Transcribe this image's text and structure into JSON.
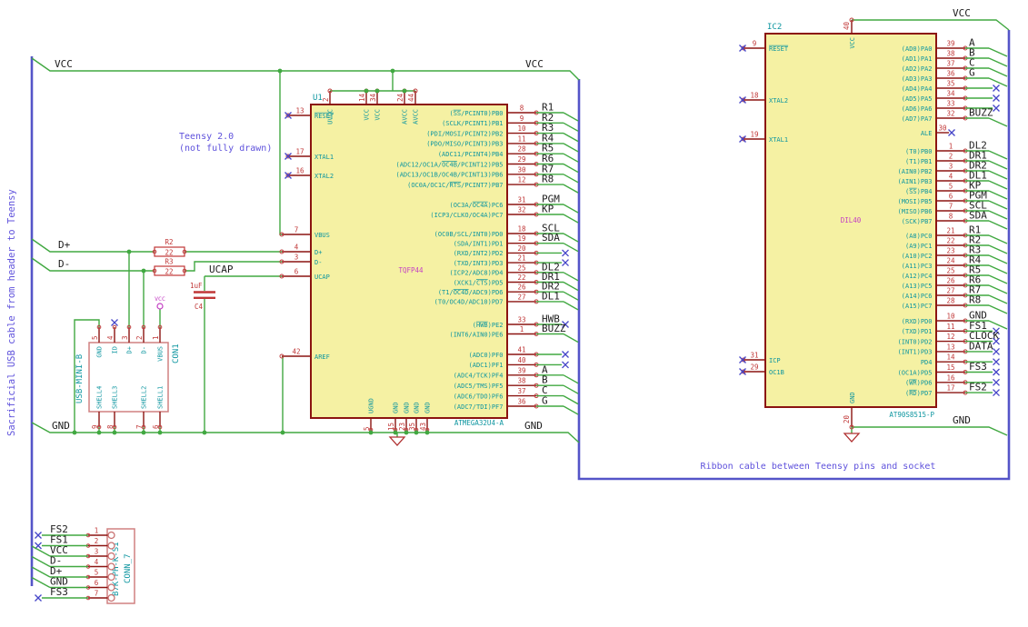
{
  "notes": {
    "side_note": "Sacrificial USB cable from header to Teensy",
    "teensy_note_line1": "Teensy 2.0",
    "teensy_note_line2": "(not fully drawn)",
    "ribbon_note": "Ribbon cable between Teensy pins and socket"
  },
  "flags": {
    "vcc_left": "VCC",
    "vcc_right": "VCC",
    "gnd_left": "GND",
    "gnd_right": "GND",
    "d_plus": "D+",
    "d_minus": "D-",
    "ucap": "UCAP",
    "ic2_vcc": "VCC",
    "ic2_gnd": "GND",
    "usb_vcc": "VCC"
  },
  "colors": {
    "wire": "#41A841",
    "bus": "#5454C8",
    "pin": "#8B1411",
    "pin_number": "#C03636",
    "pin_name": "#0E96A0",
    "reference": "#0E96A0",
    "footprint": "#C43FC4",
    "net_label": "#1C1C1C",
    "no_connect": "#4646C8",
    "note": "#5F52DC",
    "chip_fill": "#F5F1A3"
  },
  "u1": {
    "reference": "U1",
    "part": "ATMEGA32U4-A",
    "footprint": "TQFP44",
    "left_pins": [
      {
        "num": "13",
        "name": "~RESET~",
        "conn": "nc"
      },
      {
        "num": "17",
        "name": "XTAL1",
        "conn": "nc"
      },
      {
        "num": "16",
        "name": "XTAL2",
        "conn": "nc"
      },
      {
        "num": "7",
        "name": "VBUS",
        "conn": "wire"
      },
      {
        "num": "4",
        "name": "D+",
        "conn": "wire"
      },
      {
        "num": "3",
        "name": "D-",
        "conn": "wire"
      },
      {
        "num": "6",
        "name": "UCAP",
        "conn": "wire"
      },
      {
        "num": "42",
        "name": "AREF",
        "conn": "wire"
      }
    ],
    "top_pins": [
      {
        "num": "2",
        "name": "UVCC"
      },
      {
        "num": "14",
        "name": "VCC"
      },
      {
        "num": "34",
        "name": "VCC"
      },
      {
        "num": "24",
        "name": "AVCC"
      },
      {
        "num": "44",
        "name": "AVCC"
      }
    ],
    "bottom_pins": [
      {
        "num": "5",
        "name": "UGND"
      },
      {
        "num": "15",
        "name": "GND"
      },
      {
        "num": "23",
        "name": "GND"
      },
      {
        "num": "35",
        "name": "GND"
      },
      {
        "num": "43",
        "name": "GND"
      }
    ],
    "right_groups": [
      {
        "rows": [
          {
            "num": "8",
            "name": "(~SS~/PCINT0)PB0",
            "net": "R1",
            "conn": "bus"
          },
          {
            "num": "9",
            "name": "(SCLK/PCINT1)PB1",
            "net": "R2",
            "conn": "bus"
          },
          {
            "num": "10",
            "name": "(PDI/MOSI/PCINT2)PB2",
            "net": "R3",
            "conn": "bus"
          },
          {
            "num": "11",
            "name": "(PDO/MISO/PCINT3)PB3",
            "net": "R4",
            "conn": "bus"
          },
          {
            "num": "28",
            "name": "(ADC11/PCINT4)PB4",
            "net": "R5",
            "conn": "bus"
          },
          {
            "num": "29",
            "name": "(ADC12/OC1A/~OC4B~/PCINT12)PB5",
            "net": "R6",
            "conn": "bus"
          },
          {
            "num": "30",
            "name": "(ADC13/OC1B/OC4B/PCINT13)PB6",
            "net": "R7",
            "conn": "bus"
          },
          {
            "num": "12",
            "name": "(OC0A/OC1C/~RTS~/PCINT7)PB7",
            "net": "R8",
            "conn": "bus"
          }
        ]
      },
      {
        "rows": [
          {
            "num": "31",
            "name": "(OC3A/~OC4A~)PC6",
            "net": "PGM",
            "conn": "bus"
          },
          {
            "num": "32",
            "name": "(ICP3/CLKO/OC4A)PC7",
            "net": "KP",
            "conn": "bus"
          }
        ]
      },
      {
        "rows": [
          {
            "num": "18",
            "name": "(OC0B/SCL/INT0)PD0",
            "net": "SCL",
            "conn": "bus"
          },
          {
            "num": "19",
            "name": "(SDA/INT1)PD1",
            "net": "SDA",
            "conn": "bus"
          },
          {
            "num": "20",
            "name": "(RXD/INT2)PD2",
            "net": "",
            "conn": "nc"
          },
          {
            "num": "21",
            "name": "(TXD/INT3)PD3",
            "net": "",
            "conn": "nc"
          },
          {
            "num": "25",
            "name": "(ICP2/ADC8)PD4",
            "net": "DL2",
            "conn": "bus"
          },
          {
            "num": "22",
            "name": "(XCK1/~CTS~)PD5",
            "net": "DR1",
            "conn": "bus"
          },
          {
            "num": "26",
            "name": "(T1/~OC4D~/ADC9)PD6",
            "net": "DR2",
            "conn": "bus"
          },
          {
            "num": "27",
            "name": "(T0/OC4D/ADC10)PD7",
            "net": "DL1",
            "conn": "bus"
          }
        ]
      },
      {
        "rows": [
          {
            "num": "33",
            "name": "(~HWB~)PE2",
            "net": "HWB",
            "conn": "nc"
          },
          {
            "num": "1",
            "name": "(INT6/AIN0)PE6",
            "net": "BUZZ",
            "conn": "bus"
          }
        ]
      },
      {
        "rows": [
          {
            "num": "41",
            "name": "(ADC0)PF0",
            "net": "",
            "conn": "nc"
          },
          {
            "num": "40",
            "name": "(ADC1)PF1",
            "net": "",
            "conn": "nc"
          },
          {
            "num": "39",
            "name": "(ADC4/TCK)PF4",
            "net": "A",
            "conn": "bus"
          },
          {
            "num": "38",
            "name": "(ADC5/TMS)PF5",
            "net": "B",
            "conn": "bus"
          },
          {
            "num": "37",
            "name": "(ADC6/TDO)PF6",
            "net": "C",
            "conn": "bus"
          },
          {
            "num": "36",
            "name": "(ADC7/TDI)PF7",
            "net": "G",
            "conn": "bus"
          }
        ]
      }
    ]
  },
  "ic2": {
    "reference": "IC2",
    "part": "AT90S8515-P",
    "footprint": "DIL40",
    "left_pins": [
      {
        "num": "9",
        "name": "~RESET~"
      },
      {
        "num": "18",
        "name": "XTAL2"
      },
      {
        "num": "19",
        "name": "XTAL1"
      },
      {
        "num": "31",
        "name": "ICP"
      },
      {
        "num": "29",
        "name": "OC1B"
      }
    ],
    "top_pin": {
      "num": "40",
      "name": "VCC"
    },
    "bottom_pin": {
      "num": "20",
      "name": "GND"
    },
    "right_groups": [
      {
        "rows": [
          {
            "num": "39",
            "name": "(AD0)PA0",
            "net": "A",
            "conn": "bus"
          },
          {
            "num": "38",
            "name": "(AD1)PA1",
            "net": "B",
            "conn": "bus"
          },
          {
            "num": "37",
            "name": "(AD2)PA2",
            "net": "C",
            "conn": "bus"
          },
          {
            "num": "36",
            "name": "(AD3)PA3",
            "net": "G",
            "conn": "bus"
          },
          {
            "num": "35",
            "name": "(AD4)PA4",
            "net": "",
            "conn": "nc"
          },
          {
            "num": "34",
            "name": "(AD5)PA5",
            "net": "",
            "conn": "nc"
          },
          {
            "num": "33",
            "name": "(AD6)PA6",
            "net": "",
            "conn": "nc"
          },
          {
            "num": "32",
            "name": "(AD7)PA7",
            "net": "BUZZ",
            "conn": "bus"
          }
        ]
      },
      {
        "rows": [
          {
            "num": "30",
            "name": "ALE",
            "net": "",
            "conn": "nc_pin"
          }
        ]
      },
      {
        "rows": [
          {
            "num": "1",
            "name": "(T0)PB0",
            "net": "DL2",
            "conn": "bus"
          },
          {
            "num": "2",
            "name": "(T1)PB1",
            "net": "DR1",
            "conn": "bus"
          },
          {
            "num": "3",
            "name": "(AIN0)PB2",
            "net": "DR2",
            "conn": "bus"
          },
          {
            "num": "4",
            "name": "(AIN1)PB3",
            "net": "DL1",
            "conn": "bus"
          },
          {
            "num": "5",
            "name": "(~SS~)PB4",
            "net": "KP",
            "conn": "bus"
          },
          {
            "num": "6",
            "name": "(MOSI)PB5",
            "net": "PGM",
            "conn": "bus"
          },
          {
            "num": "7",
            "name": "(MISO)PB6",
            "net": "SCL",
            "conn": "bus"
          },
          {
            "num": "8",
            "name": "(SCK)PB7",
            "net": "SDA",
            "conn": "bus"
          }
        ]
      },
      {
        "rows": [
          {
            "num": "21",
            "name": "(A8)PC0",
            "net": "R1",
            "conn": "bus"
          },
          {
            "num": "22",
            "name": "(A9)PC1",
            "net": "R2",
            "conn": "bus"
          },
          {
            "num": "23",
            "name": "(A10)PC2",
            "net": "R3",
            "conn": "bus"
          },
          {
            "num": "24",
            "name": "(A11)PC3",
            "net": "R4",
            "conn": "bus"
          },
          {
            "num": "25",
            "name": "(A12)PC4",
            "net": "R5",
            "conn": "bus"
          },
          {
            "num": "26",
            "name": "(A13)PC5",
            "net": "R6",
            "conn": "bus"
          },
          {
            "num": "27",
            "name": "(A14)PC6",
            "net": "R7",
            "conn": "bus"
          },
          {
            "num": "28",
            "name": "(A15)PC7",
            "net": "R8",
            "conn": "bus"
          }
        ]
      },
      {
        "rows": [
          {
            "num": "10",
            "name": "(RXD)PD0",
            "net": "GND",
            "conn": "bus"
          },
          {
            "num": "11",
            "name": "(TXD)PD1",
            "net": "FS1",
            "conn": "nc"
          },
          {
            "num": "12",
            "name": "(INT0)PD2",
            "net": "CLOCK",
            "conn": "nc"
          },
          {
            "num": "13",
            "name": "(INT1)PD3",
            "net": "DATA",
            "conn": "nc"
          },
          {
            "num": "14",
            "name": "PD4",
            "net": "",
            "conn": "nc"
          },
          {
            "num": "15",
            "name": "(OC1A)PD5",
            "net": "FS3",
            "conn": "nc"
          },
          {
            "num": "16",
            "name": "(~WR~)PD6",
            "net": "",
            "conn": "nc"
          },
          {
            "num": "17",
            "name": "(~RD~)PD7",
            "net": "FS2",
            "conn": "nc"
          }
        ]
      }
    ]
  },
  "conn1": {
    "reference": "CON1",
    "part_label": "USB-MINI-B",
    "top_pins": [
      {
        "num": "5",
        "name": "GND"
      },
      {
        "num": "4",
        "name": "ID"
      },
      {
        "num": "3",
        "name": "D+"
      },
      {
        "num": "2",
        "name": "D-"
      },
      {
        "num": "1",
        "name": "VBUS"
      }
    ],
    "bottom_pins": [
      {
        "num": "9",
        "name": "SHELL4"
      },
      {
        "num": "8",
        "name": "SHELL3"
      },
      {
        "num": "7",
        "name": "SHELL2"
      },
      {
        "num": "6",
        "name": "SHELL1"
      }
    ]
  },
  "conn7": {
    "reference": "CONN_7",
    "part": "B7K-PH-K-S1",
    "pins": [
      {
        "num": "1",
        "net": "FS2",
        "conn": "nc"
      },
      {
        "num": "2",
        "net": "FS1",
        "conn": "nc"
      },
      {
        "num": "3",
        "net": "VCC",
        "conn": "bus"
      },
      {
        "num": "4",
        "net": "D-",
        "conn": "bus"
      },
      {
        "num": "5",
        "net": "D+",
        "conn": "bus"
      },
      {
        "num": "6",
        "net": "GND",
        "conn": "bus"
      },
      {
        "num": "7",
        "net": "FS3",
        "conn": "nc"
      }
    ]
  },
  "r2": {
    "reference": "R2",
    "value": "22"
  },
  "r3": {
    "reference": "R3",
    "value": "22"
  },
  "c4": {
    "reference": "C4",
    "value": "1uF"
  }
}
